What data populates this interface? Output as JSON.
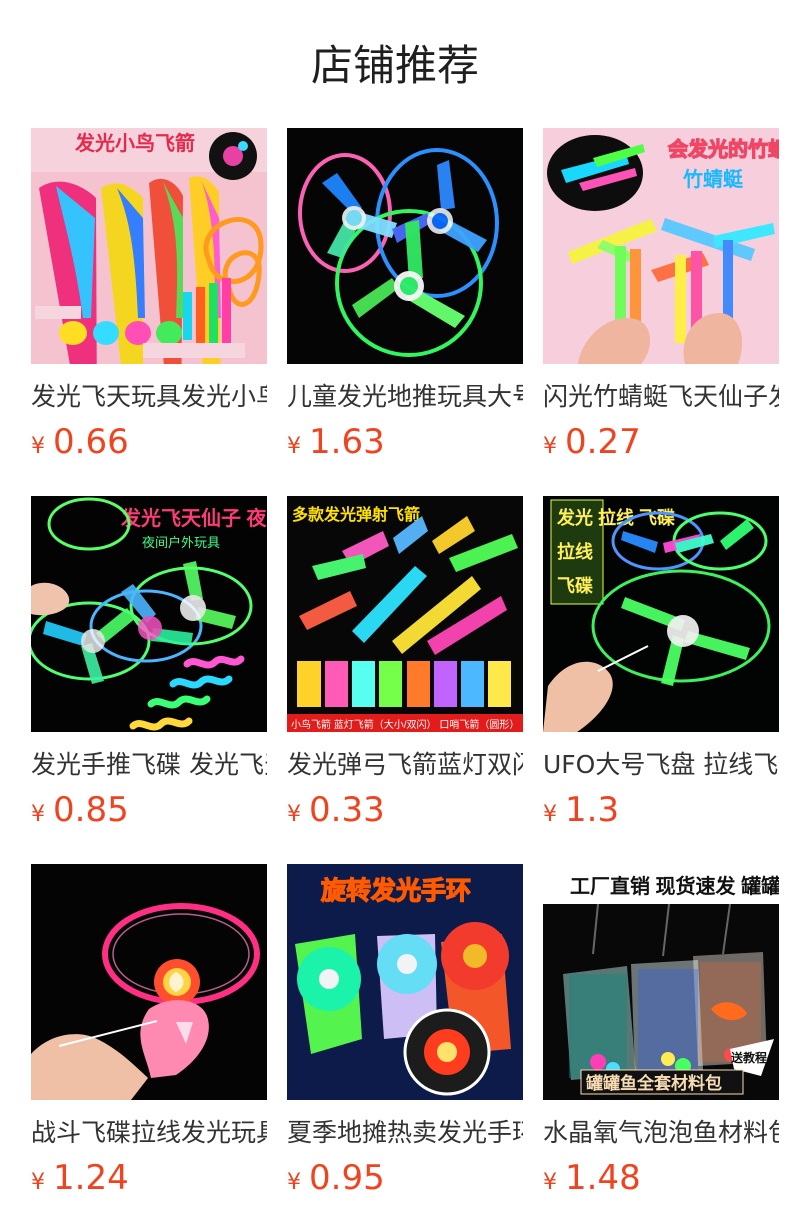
{
  "header": {
    "title": "店铺推荐"
  },
  "products": [
    {
      "title": "发光飞天玩具发光小鸟飞箭",
      "currency": "¥",
      "price": "0.66",
      "image_text": "发光小鸟飞箭",
      "image": "glowing bird arrow toys on pink background",
      "bg": "#f4c3cf",
      "accent": "#e62a4b"
    },
    {
      "title": "儿童发光地推玩具大号飞碟",
      "currency": "¥",
      "price": "1.63",
      "image_text": "",
      "image": "three glowing hand-push flying saucers on black",
      "bg": "#050505",
      "accent": "#41e36d"
    },
    {
      "title": "闪光竹蜻蜓飞天仙子发光玩具",
      "currency": "¥",
      "price": "0.27",
      "image_text": "会发光的竹蜻蜓",
      "image": "glowing bamboo dragonfly toys on pink background",
      "bg": "#f7cfdc",
      "accent": "#ffde00"
    },
    {
      "title": "发光手推飞碟 发光飞天仙子",
      "currency": "¥",
      "price": "0.85",
      "image_text": "发光飞天仙子 夜间户外玩具",
      "image": "glowing flying fairy toys on black",
      "bg": "#020302",
      "accent": "#ff3b77"
    },
    {
      "title": "发光弹弓飞箭蓝灯双闪飞箭",
      "currency": "¥",
      "price": "0.33",
      "image_text": "多款发光弹射飞箭",
      "image": "many glowing slingshot arrows on black",
      "bg": "#070707",
      "accent": "#ffe100"
    },
    {
      "title": "UFO大号飞盘 拉线飞碟发光",
      "currency": "¥",
      "price": "1.3",
      "image_text": "发光 拉线 飞碟",
      "image": "glowing pull string UFO discs on black",
      "bg": "#020303",
      "accent": "#29ef75"
    },
    {
      "title": "战斗飞碟拉线发光玩具枪",
      "currency": "¥",
      "price": "1.24",
      "image_text": "",
      "image": "pink glowing pull string flying disc gun",
      "bg": "#040404",
      "accent": "#ff2f84"
    },
    {
      "title": "夏季地摊热卖发光手环陀螺",
      "currency": "¥",
      "price": "0.95",
      "image_text": "旋转发光手环",
      "image": "glowing spinning wrist bands on dark blue",
      "bg": "#0d1b4a",
      "accent": "#ffcc00"
    },
    {
      "title": "水晶氧气泡泡鱼材料包",
      "currency": "¥",
      "price": "1.48",
      "image_text": "工厂直销 现货速发 罐罐鱼全套材料包 送教程",
      "image": "glowing jar fish aquarium lights on black",
      "bg": "#080808",
      "accent": "#f7dcb3"
    }
  ]
}
